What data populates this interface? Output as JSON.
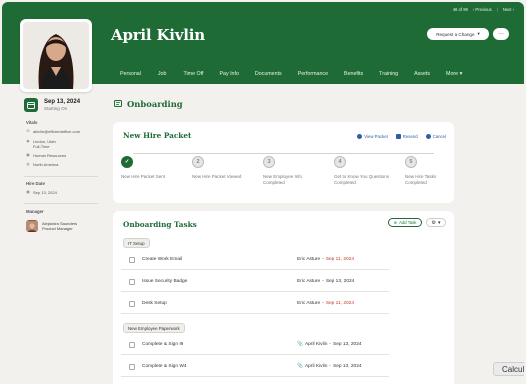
{
  "pager": {
    "count": "46 of 99",
    "previous": "Previous",
    "next": "Next"
  },
  "employee": {
    "name": "April Kivlin"
  },
  "actions": {
    "request_change": "Request a Change",
    "more": "···"
  },
  "tabs": [
    "Personal",
    "Job",
    "Time Off",
    "Pay Info",
    "Documents",
    "Performance",
    "Benefits",
    "Training",
    "Assets",
    "More"
  ],
  "sidebar": {
    "start_date": "Sep 13, 2024",
    "start_label": "Starting On",
    "vitals_label": "Vitals",
    "vitals": [
      "akivlin@efficientoffice.com",
      "Lindon, Utah",
      "Full-Time",
      "Human Resources",
      "North America"
    ],
    "hire_label": "Hire Date",
    "hire_date": "Sep 13, 2024",
    "manager_label": "Manager",
    "manager_name": "Alejandra Saunders",
    "manager_title": "Product Manager"
  },
  "section": {
    "title": "Onboarding"
  },
  "packet": {
    "title": "New Hire Packet",
    "links": {
      "view": "View Packet",
      "resend": "Resend",
      "cancel": "Cancel"
    },
    "steps": [
      {
        "num": "",
        "label": "New Hire Packet Sent",
        "done": true
      },
      {
        "num": "2",
        "label": "New Hire Packet Viewed",
        "done": false
      },
      {
        "num": "3",
        "label": "New Employee Info Completed",
        "done": false
      },
      {
        "num": "4",
        "label": "Get to Know You Questions Completed",
        "done": false
      },
      {
        "num": "5",
        "label": "New Hire Tasks Completed",
        "done": false
      }
    ]
  },
  "tasks": {
    "title": "Onboarding Tasks",
    "add_task": "Add Task",
    "groups": [
      {
        "name": "IT Setup",
        "rows": [
          {
            "name": "Create Work Email",
            "assignee": "Eric Asture",
            "due": "Sep 11, 2024",
            "overdue": true
          },
          {
            "name": "Issue Security Badge",
            "assignee": "Eric Asture",
            "due": "Sep 13, 2024",
            "overdue": false
          },
          {
            "name": "Desk Setup",
            "assignee": "Eric Asture",
            "due": "Sep 11, 2024",
            "overdue": true
          }
        ]
      },
      {
        "name": "New Employee Paperwork",
        "rows": [
          {
            "name": "Complete & Sign I9",
            "assignee": "April Kivlin",
            "due": "Sep 13, 2024",
            "overdue": false
          },
          {
            "name": "Complete & Sign W4",
            "assignee": "April Kivlin",
            "due": "Sep 13, 2024",
            "overdue": false
          }
        ]
      }
    ]
  },
  "calc": "Calcula",
  "colors": {
    "brand_green": "#1e6b35",
    "overdue_red": "#c0392b",
    "link_blue": "#2c5fa8"
  }
}
